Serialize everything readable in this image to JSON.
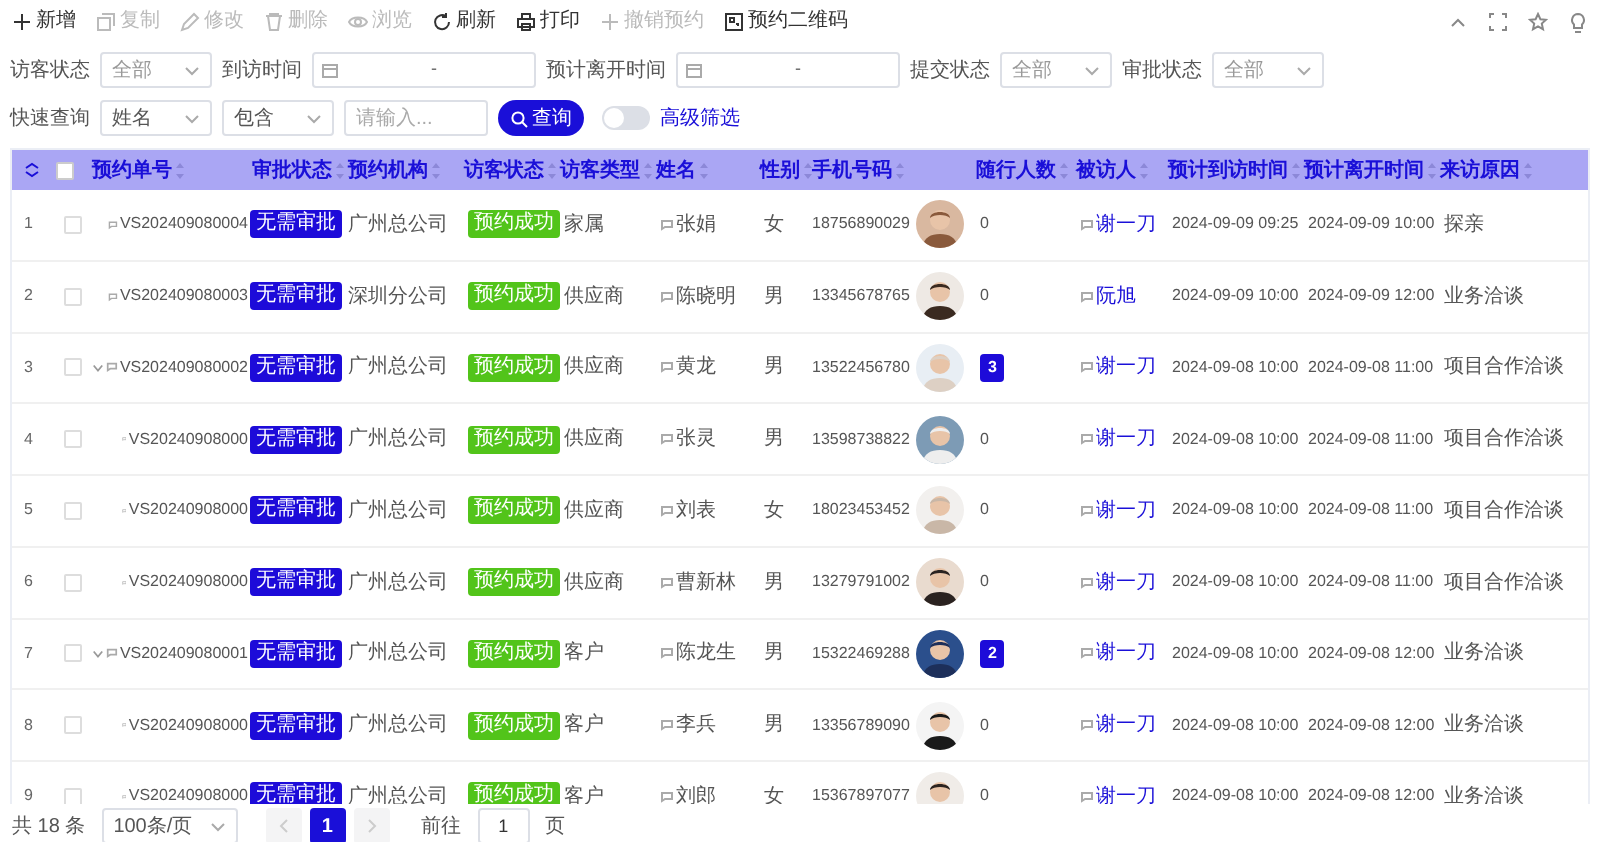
{
  "toolbar": [
    {
      "label": "新增",
      "kind": "plus",
      "disabled": false
    },
    {
      "label": "复制",
      "kind": "copy",
      "disabled": true
    },
    {
      "label": "修改",
      "kind": "edit",
      "disabled": true
    },
    {
      "label": "删除",
      "kind": "trash",
      "disabled": true
    },
    {
      "label": "浏览",
      "kind": "eye",
      "disabled": true
    },
    {
      "label": "刷新",
      "kind": "refresh",
      "disabled": false
    },
    {
      "label": "打印",
      "kind": "print",
      "disabled": false
    },
    {
      "label": "撤销预约",
      "kind": "plus",
      "disabled": true
    },
    {
      "label": "预约二维码",
      "kind": "qr",
      "disabled": false
    }
  ],
  "filters": [
    {
      "label": "访客状态",
      "kind": "select",
      "value": "全部"
    },
    {
      "label": "到访时间",
      "kind": "daterange",
      "separator": "-"
    },
    {
      "label": "预计离开时间",
      "kind": "daterange",
      "separator": "-"
    },
    {
      "label": "提交状态",
      "kind": "select",
      "value": "全部"
    },
    {
      "label": "审批状态",
      "kind": "select",
      "value": "全部"
    }
  ],
  "quick_search": {
    "label": "快速查询",
    "field": "姓名",
    "operator": "包含",
    "placeholder": "请输入...",
    "button": "查询",
    "advanced": {
      "label": "高级筛选",
      "on": false
    }
  },
  "table": {
    "select_all": {
      "checked": false
    },
    "columns": [
      "预约单号",
      "审批状态",
      "预约机构",
      "访客状态",
      "访客类型",
      "姓名",
      "性别",
      "手机号码",
      "随行人数",
      "被访人",
      "预计到访时间",
      "预计离开时间",
      "来访原因"
    ],
    "rows": [
      {
        "index": "1",
        "checked": false,
        "id": "VS202409080004",
        "approval": "无需审批",
        "org": "广州总公司",
        "visit_status": "预约成功",
        "type": "家属",
        "name": "张娟",
        "gender": "女",
        "phone": "18756890029",
        "companions": {
          "text": "0",
          "highlighted": false
        },
        "host": "谢一刀",
        "arrival": "2024-09-09 09:25",
        "departure": "2024-09-09 10:00",
        "reason": "探亲"
      },
      {
        "index": "2",
        "checked": false,
        "id": "VS202409080003",
        "approval": "无需审批",
        "org": "深圳分公司",
        "visit_status": "预约成功",
        "type": "供应商",
        "name": "陈晓明",
        "gender": "男",
        "phone": "13345678765",
        "companions": {
          "text": "0",
          "highlighted": false
        },
        "host": "阮旭",
        "arrival": "2024-09-09 10:00",
        "departure": "2024-09-09 12:00",
        "reason": "业务洽谈"
      },
      {
        "index": "3",
        "checked": false,
        "expanded": true,
        "id": "VS202409080002",
        "approval": "无需审批",
        "org": "广州总公司",
        "visit_status": "预约成功",
        "type": "供应商",
        "name": "黄龙",
        "gender": "男",
        "phone": "13522456780",
        "companions": {
          "text": "3",
          "highlighted": true
        },
        "host": "谢一刀",
        "arrival": "2024-09-08 10:00",
        "departure": "2024-09-08 11:00",
        "reason": "项目合作洽谈",
        "children": [
          {
            "index": "4",
            "checked": false,
            "id": "VS20240908000",
            "approval": "无需审批",
            "org": "广州总公司",
            "visit_status": "预约成功",
            "type": "供应商",
            "name": "张灵",
            "gender": "男",
            "phone": "13598738822",
            "companions": {
              "text": "0",
              "highlighted": false
            },
            "host": "谢一刀",
            "arrival": "2024-09-08 10:00",
            "departure": "2024-09-08 11:00",
            "reason": "项目合作洽谈"
          },
          {
            "index": "5",
            "checked": false,
            "id": "VS20240908000",
            "approval": "无需审批",
            "org": "广州总公司",
            "visit_status": "预约成功",
            "type": "供应商",
            "name": "刘表",
            "gender": "女",
            "phone": "18023453452",
            "companions": {
              "text": "0",
              "highlighted": false
            },
            "host": "谢一刀",
            "arrival": "2024-09-08 10:00",
            "departure": "2024-09-08 11:00",
            "reason": "项目合作洽谈"
          },
          {
            "index": "6",
            "checked": false,
            "id": "VS20240908000",
            "approval": "无需审批",
            "org": "广州总公司",
            "visit_status": "预约成功",
            "type": "供应商",
            "name": "曹新林",
            "gender": "男",
            "phone": "13279791002",
            "companions": {
              "text": "0",
              "highlighted": false
            },
            "host": "谢一刀",
            "arrival": "2024-09-08 10:00",
            "departure": "2024-09-08 11:00",
            "reason": "项目合作洽谈"
          }
        ]
      },
      {
        "index": "7",
        "checked": false,
        "expanded": true,
        "id": "VS202409080001",
        "approval": "无需审批",
        "org": "广州总公司",
        "visit_status": "预约成功",
        "type": "客户",
        "name": "陈龙生",
        "gender": "男",
        "phone": "15322469288",
        "companions": {
          "text": "2",
          "highlighted": true
        },
        "host": "谢一刀",
        "arrival": "2024-09-08 10:00",
        "departure": "2024-09-08 12:00",
        "reason": "业务洽谈",
        "children": [
          {
            "index": "8",
            "checked": false,
            "id": "VS20240908000",
            "approval": "无需审批",
            "org": "广州总公司",
            "visit_status": "预约成功",
            "type": "客户",
            "name": "李兵",
            "gender": "男",
            "phone": "13356789090",
            "companions": {
              "text": "0",
              "highlighted": false
            },
            "host": "谢一刀",
            "arrival": "2024-09-08 10:00",
            "departure": "2024-09-08 12:00",
            "reason": "业务洽谈"
          },
          {
            "index": "9",
            "checked": false,
            "id": "VS20240908000",
            "approval": "无需审批",
            "org": "广州总公司",
            "visit_status": "预约成功",
            "type": "客户",
            "name": "刘郎",
            "gender": "女",
            "phone": "15367897077",
            "companions": {
              "text": "0",
              "highlighted": false
            },
            "host": "谢一刀",
            "arrival": "2024-09-08 10:00",
            "departure": "2024-09-08 12:00",
            "reason": "业务洽谈"
          }
        ]
      }
    ]
  },
  "footer": {
    "total": "共 18 条",
    "page_size": "100条/页",
    "pages": [
      {
        "label": "1",
        "selected": true
      }
    ],
    "goto_label": "前往",
    "goto_value": "1",
    "goto_suffix": "页"
  }
}
